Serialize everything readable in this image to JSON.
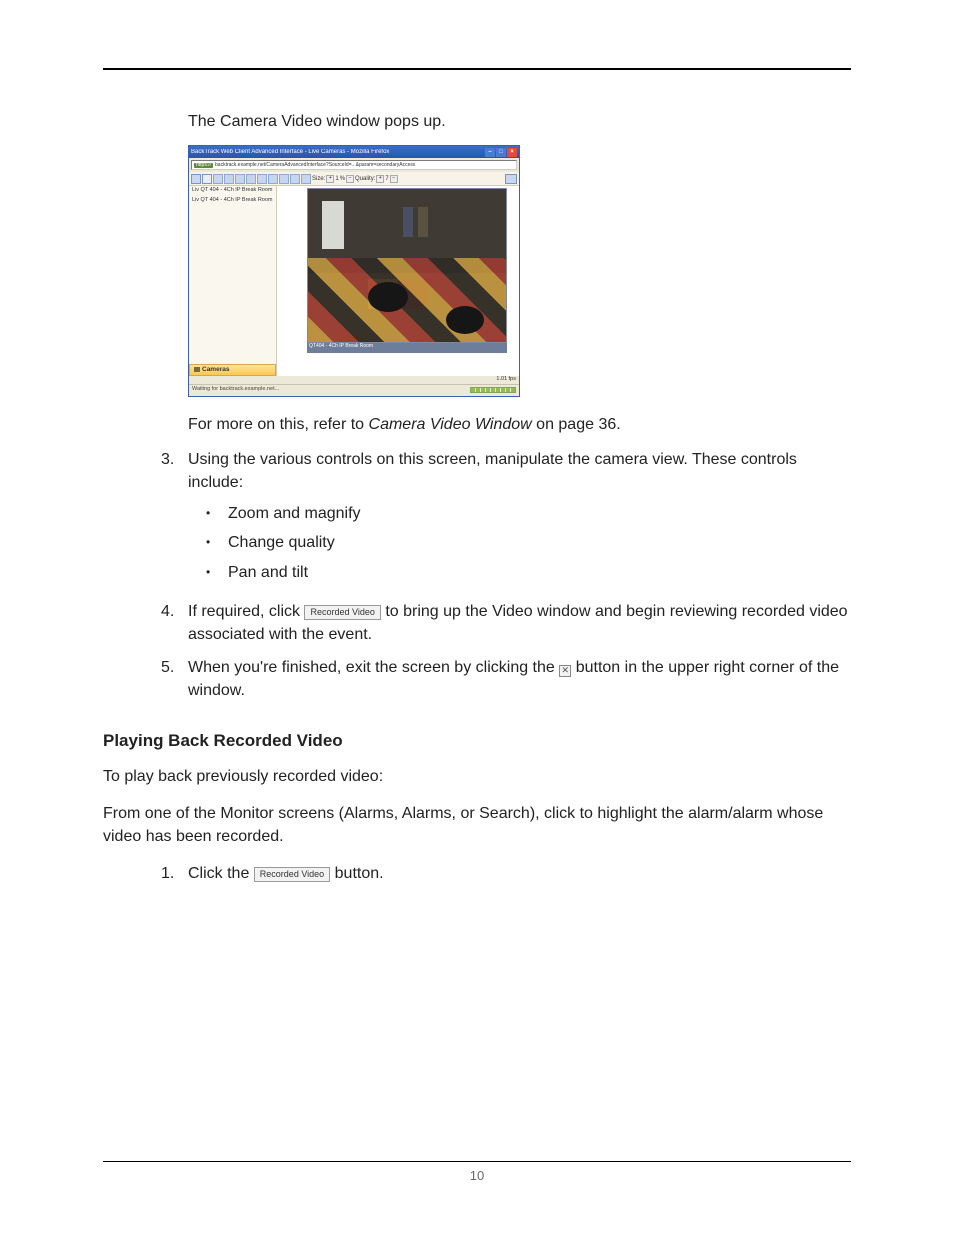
{
  "intro": "The Camera Video window pops up.",
  "screenshot": {
    "title": "BackTrack Web Client Advanced Interface - Live Cameras - Mozilla Firefox",
    "url_prefix": "https://",
    "url": "backtrack.example.net/CameraAdvancedInterface?SourceId=...&param=secondaryAccess",
    "toolbar_size_label": "Size:",
    "toolbar_plus": "+",
    "toolbar_scale": "1",
    "toolbar_unit": "%",
    "toolbar_minus": "−",
    "toolbar_quality_label": "Quality:",
    "toolbar_quality_plus": "+",
    "toolbar_quality_val": "7",
    "toolbar_quality_minus": "−",
    "side_items": [
      "Liv QT 404 - 4Ch IP Break Room",
      "Liv QT 404 - 4Ch IP Break Room"
    ],
    "cameras_label": "Cameras",
    "video_caption": "QT404 - 4Ch IP Break Room",
    "fps": "1.01 fps",
    "status_left": "Waiting for backtrack.example.net..."
  },
  "refer_text_1": "For more on this, refer to ",
  "refer_link": "Camera Video Window",
  "refer_text_2": " on page 36.",
  "list": {
    "item3": {
      "num": "3.",
      "text": "Using the various controls on this screen, manipulate the camera view. These controls include:",
      "bullets": [
        "Zoom and magnify",
        "Change quality",
        "Pan and tilt"
      ]
    },
    "item4": {
      "num": "4.",
      "pre": "If required, click ",
      "btn": "Recorded Video",
      "post": " to bring up the Video window and begin reviewing recorded video associated with the event."
    },
    "item5": {
      "num": "5.",
      "pre": "When you're finished, exit the screen by clicking the ",
      "post": " button in the upper right corner of the window."
    }
  },
  "section_heading": "Playing Back Recorded Video",
  "playback_intro": "To play back previously recorded video:",
  "playback_body": "From one of the Monitor screens (Alarms, Alarms, or Search), click to highlight the alarm/alarm whose video has been recorded.",
  "playback_item1": {
    "num": "1.",
    "pre": "Click the ",
    "btn": "Recorded Video",
    "post": " button."
  },
  "page_number": "10"
}
